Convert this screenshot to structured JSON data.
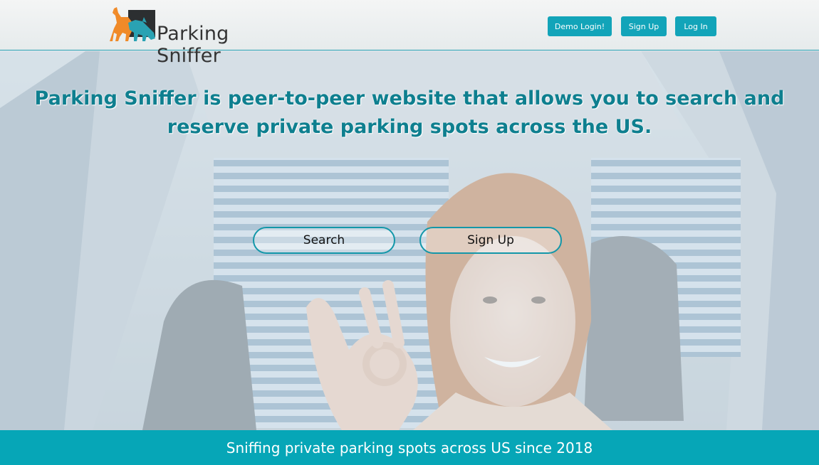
{
  "header": {
    "logo_text": "Parking Sniffer",
    "buttons": {
      "demo_login": "Demo Login!",
      "sign_up": "Sign Up",
      "log_in": "Log In"
    }
  },
  "hero": {
    "headline": "Parking Sniffer is peer-to-peer website that allows you to search and reserve private parking spots across the US.",
    "search_label": "Search",
    "signup_label": "Sign Up"
  },
  "footer": {
    "tagline": "Sniffing private parking spots across US since 2018"
  },
  "colors": {
    "accent": "#12a4b9",
    "headline": "#0e7f8f",
    "footer_bg": "#06a6b7",
    "logo_dog_orange": "#f08a28",
    "logo_dog_teal": "#2aa2b3"
  },
  "icons": {
    "logo": "dog-sniffing-logo-icon"
  }
}
